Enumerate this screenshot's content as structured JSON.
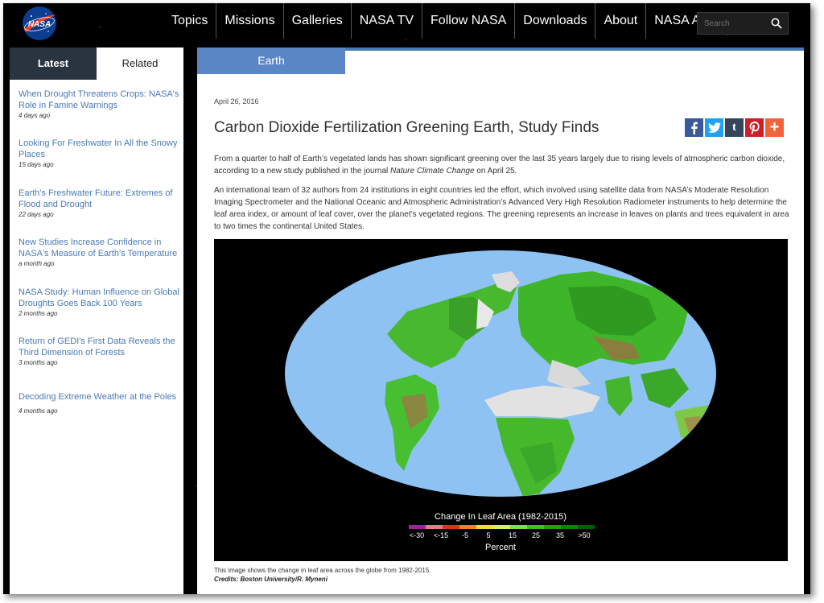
{
  "header": {
    "nav": [
      "Topics",
      "Missions",
      "Galleries",
      "NASA TV",
      "Follow NASA",
      "Downloads",
      "About",
      "NASA Audiences"
    ],
    "search_placeholder": "Search",
    "logo_text": "NASA"
  },
  "sidebar": {
    "tabs": {
      "latest": "Latest",
      "related": "Related"
    },
    "items": [
      {
        "title": "When Drought Threatens Crops: NASA's Role in Famine Warnings",
        "date": "4 days ago"
      },
      {
        "title": "Looking For Freshwater In All the Snowy Places",
        "date": "15 days ago"
      },
      {
        "title": "Earth's Freshwater Future: Extremes of Flood and Drought",
        "date": "22 days ago"
      },
      {
        "title": "New Studies Increase Confidence in NASA's Measure of Earth's Temperature",
        "date": "a month ago"
      },
      {
        "title": "NASA Study: Human Influence on Global Droughts Goes Back 100 Years",
        "date": "2 months ago"
      },
      {
        "title": "Return of GEDI's First Data Reveals the Third Dimension of Forests",
        "date": "3 months ago"
      },
      {
        "title": "Decoding Extreme Weather at the Poles",
        "date": "4 months ago"
      }
    ]
  },
  "article": {
    "category": "Earth",
    "date": "April 26, 2016",
    "title": "Carbon Dioxide Fertilization Greening Earth, Study Finds",
    "p1_before": "From a quarter to half of Earth’s vegetated lands has shown significant greening over the last 35 years largely due to rising levels of atmospheric carbon dioxide, according to a new study published in the journal ",
    "p1_journal": "Nature Climate Change",
    "p1_after": " on April 25.",
    "p2": "An international team of 32 authors from 24 institutions in eight countries led the effort, which involved using satellite data from NASA’s Moderate Resolution Imaging Spectrometer and the National Oceanic and Atmospheric Administration’s Advanced Very High Resolution Radiometer instruments to help determine the leaf area index, or amount of leaf cover, over the planet’s vegetated regions. The greening represents an increase in leaves on plants and trees equivalent in area to two times the continental United States.",
    "caption": "This image shows the change in leaf area across the globe from 1982-2015.",
    "credits": "Credits: Boston University/R. Myneni"
  },
  "share": [
    {
      "name": "facebook",
      "glyph": "f",
      "color": "#3b5998"
    },
    {
      "name": "twitter",
      "glyph": "t",
      "color": "#1da1f2"
    },
    {
      "name": "tumblr",
      "glyph": "t",
      "color": "#35465c"
    },
    {
      "name": "pinterest",
      "glyph": "P",
      "color": "#cb2027"
    },
    {
      "name": "more",
      "glyph": "+",
      "color": "#f0643c"
    }
  ],
  "figure": {
    "legend_title": "Change In Leaf Area (1982-2015)",
    "legend_ticks": [
      "<-30",
      "<-15",
      "-5",
      "5",
      "15",
      "25",
      "35",
      ">50"
    ],
    "legend_unit": "Percent",
    "legend_colors": [
      "#a020a0",
      "#e08080",
      "#e03020",
      "#f08020",
      "#f0e020",
      "#d0f060",
      "#80e040",
      "#40c020",
      "#20a010",
      "#108008",
      "#006000"
    ]
  }
}
